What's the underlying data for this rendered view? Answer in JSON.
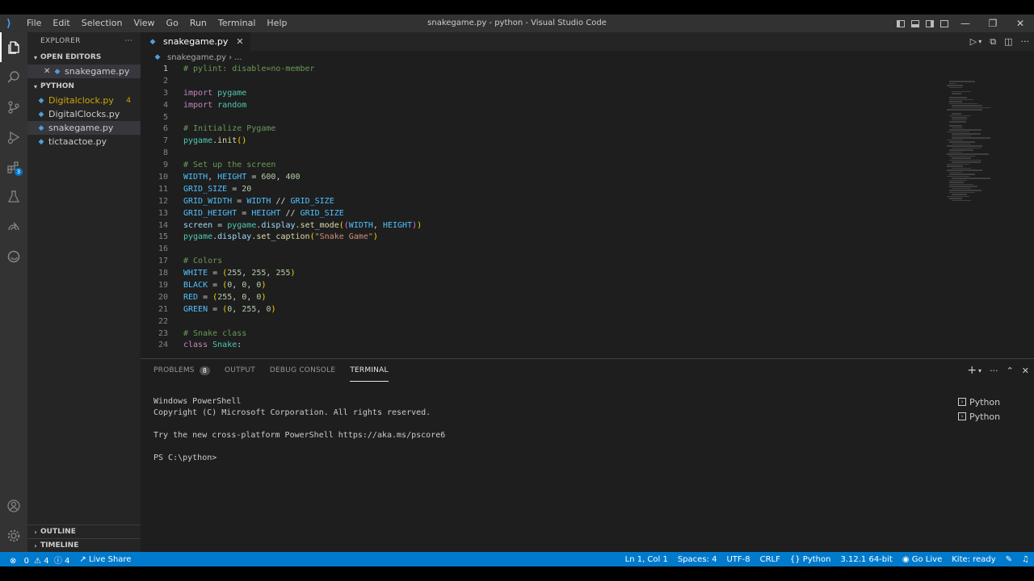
{
  "window": {
    "title": "snakegame.py - python - Visual Studio Code"
  },
  "menu": [
    "File",
    "Edit",
    "Selection",
    "View",
    "Go",
    "Run",
    "Terminal",
    "Help"
  ],
  "activity": {
    "extensions_badge": "3"
  },
  "explorer": {
    "header": "EXPLORER",
    "open_editors_label": "OPEN EDITORS",
    "open_editor_file": "snakegame.py",
    "folder_label": "PYTHON",
    "files": [
      {
        "name": "Digitalclock.py",
        "badge": "4"
      },
      {
        "name": "DigitalClocks.py",
        "badge": ""
      },
      {
        "name": "snakegame.py",
        "badge": ""
      },
      {
        "name": "tictaactoe.py",
        "badge": ""
      }
    ],
    "outline_label": "OUTLINE",
    "timeline_label": "TIMELINE"
  },
  "editor": {
    "tab_label": "snakegame.py",
    "breadcrumb_file": "snakegame.py",
    "breadcrumb_more": "...",
    "lines": [
      "# pylint: disable=no-member",
      "",
      "import pygame",
      "import random",
      "",
      "# Initialize Pygame",
      "pygame.init()",
      "",
      "# Set up the screen",
      "WIDTH, HEIGHT = 600, 400",
      "GRID_SIZE = 20",
      "GRID_WIDTH = WIDTH // GRID_SIZE",
      "GRID_HEIGHT = HEIGHT // GRID_SIZE",
      "screen = pygame.display.set_mode((WIDTH, HEIGHT))",
      "pygame.display.set_caption(\"Snake Game\")",
      "",
      "# Colors",
      "WHITE = (255, 255, 255)",
      "BLACK = (0, 0, 0)",
      "RED = (255, 0, 0)",
      "GREEN = (0, 255, 0)",
      "",
      "# Snake class",
      "class Snake:"
    ]
  },
  "panel": {
    "tabs": {
      "problems": "PROBLEMS",
      "problems_count": "8",
      "output": "OUTPUT",
      "debug": "DEBUG CONSOLE",
      "terminal": "TERMINAL"
    },
    "terminal_lines": [
      "Windows PowerShell",
      "Copyright (C) Microsoft Corporation. All rights reserved.",
      "",
      "Try the new cross-platform PowerShell https://aka.ms/pscore6",
      "",
      "PS C:\\python>"
    ],
    "terminals": [
      "Python",
      "Python"
    ]
  },
  "status": {
    "errors": "0",
    "warnings": "4",
    "info": "4",
    "live_share": "Live Share",
    "position": "Ln 1, Col 1",
    "spaces": "Spaces: 4",
    "encoding": "UTF-8",
    "eol": "CRLF",
    "language": "Python",
    "interpreter": "3.12.1 64-bit",
    "go_live": "Go Live",
    "ready": "Kite: ready"
  },
  "colors": {
    "accent": "#007acc",
    "comment": "#6a9955",
    "keyword": "#c586c0",
    "string": "#ce9178"
  }
}
